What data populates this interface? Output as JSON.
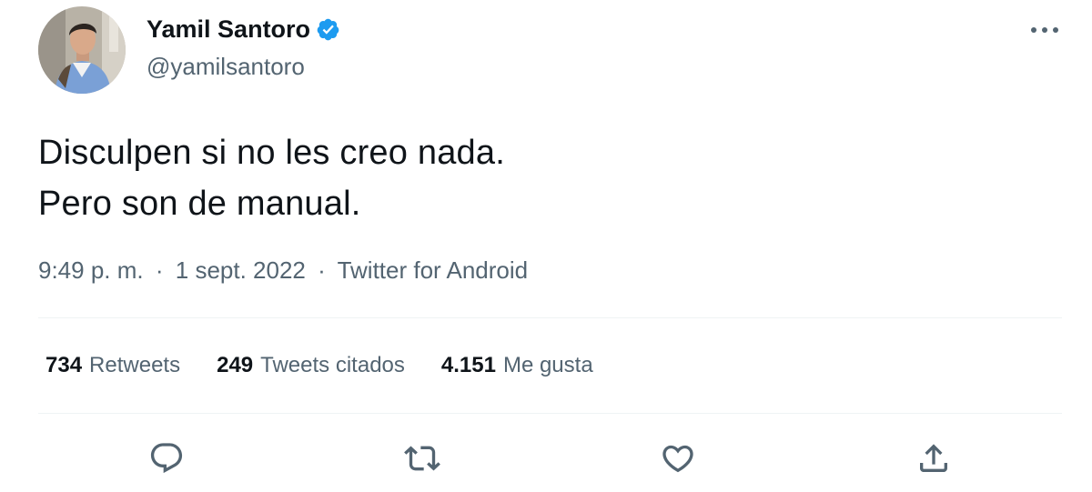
{
  "author": {
    "display_name": "Yamil Santoro",
    "handle": "@yamilsantoro",
    "verified": true
  },
  "tweet": {
    "lines": [
      "Disculpen si no les creo nada.",
      "Pero son de manual."
    ]
  },
  "meta": {
    "time": "9:49 p. m.",
    "separator": "·",
    "date": "1 sept. 2022",
    "source": "Twitter for Android"
  },
  "stats": [
    {
      "count": "734",
      "label": "Retweets"
    },
    {
      "count": "249",
      "label": "Tweets citados"
    },
    {
      "count": "4.151",
      "label": "Me gusta"
    }
  ],
  "actions": {
    "icons": [
      "reply-icon",
      "retweet-icon",
      "like-icon",
      "share-icon"
    ]
  },
  "colors": {
    "text_primary": "#0f1419",
    "text_secondary": "#536471",
    "verified_blue": "#1d9bf0",
    "divider": "#eff3f4"
  }
}
